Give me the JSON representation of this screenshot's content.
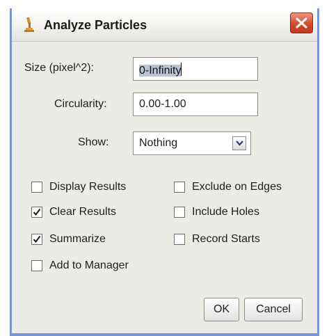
{
  "window": {
    "title": "Analyze Particles",
    "colors": {
      "background": "#ecebe6",
      "frame": "#7a96d8",
      "close": "#d14a2d"
    }
  },
  "fields": {
    "size_label": "Size (pixel^2):",
    "size_value": "0-Infinity",
    "circularity_label": "Circularity:",
    "circularity_value": "0.00-1.00",
    "show_label": "Show:",
    "show_value": "Nothing"
  },
  "checkboxes": {
    "display_results": {
      "label": "Display Results",
      "checked": false
    },
    "exclude_on_edges": {
      "label": "Exclude on Edges",
      "checked": false
    },
    "clear_results": {
      "label": "Clear Results",
      "checked": true
    },
    "include_holes": {
      "label": "Include Holes",
      "checked": false
    },
    "summarize": {
      "label": "Summarize",
      "checked": true
    },
    "record_starts": {
      "label": "Record Starts",
      "checked": false
    },
    "add_to_manager": {
      "label": "Add to Manager",
      "checked": false
    }
  },
  "buttons": {
    "ok": "OK",
    "cancel": "Cancel"
  },
  "icons": {
    "app": "microscope-icon",
    "close": "close-icon",
    "dropdown": "chevron-down-icon",
    "check": "checkmark-icon"
  }
}
